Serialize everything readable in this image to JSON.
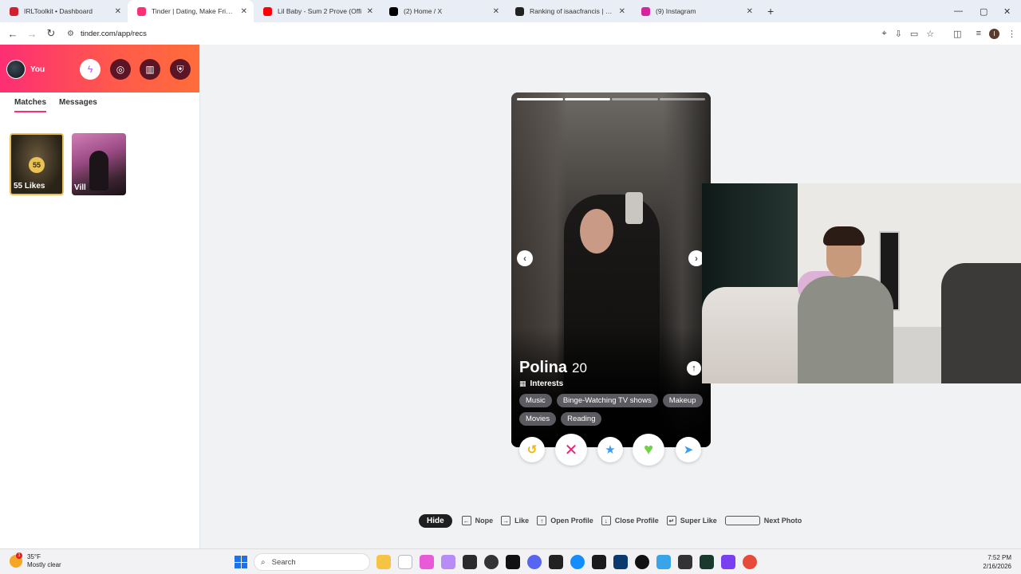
{
  "browser": {
    "tabs": [
      {
        "title": "IRLToolkit • Dashboard",
        "icon": "irltoolkit-icon",
        "color": "#d11f2e",
        "active": false
      },
      {
        "title": "Tinder | Dating, Make Friends &",
        "icon": "tinder-flame-icon",
        "color": "#fd2e74",
        "active": true
      },
      {
        "title": "Lil Baby - Sum 2 Prove (Offi",
        "icon": "youtube-icon",
        "color": "#ff0000",
        "active": false
      },
      {
        "title": "(2) Home / X",
        "icon": "x-icon",
        "color": "#000000",
        "active": false
      },
      {
        "title": "Ranking of isaacfrancis | BotRi",
        "icon": "botrix-icon",
        "color": "#222222",
        "active": false
      },
      {
        "title": "(9) Instagram",
        "icon": "instagram-icon",
        "color": "#d6249f",
        "active": false
      }
    ],
    "url": "tinder.com/app/recs",
    "profile_initial": "I"
  },
  "sidebar": {
    "user_label": "You",
    "tabs": [
      "Matches",
      "Messages"
    ],
    "active_tab": "Matches",
    "likes": {
      "count": "55",
      "label": "55 Likes"
    },
    "matches": [
      {
        "name": "Vill"
      }
    ]
  },
  "card": {
    "name": "Polina",
    "age": "20",
    "photo_count": 4,
    "current_photo": 2,
    "interests_heading": "Interests",
    "interests": [
      "Music",
      "Binge-Watching TV shows",
      "Makeup",
      "Movies",
      "Reading"
    ]
  },
  "actions": [
    {
      "name": "rewind",
      "icon": "rewind-icon",
      "color": "#f5b400"
    },
    {
      "name": "nope",
      "icon": "x-icon",
      "color": "#e8247a"
    },
    {
      "name": "super-like",
      "icon": "star-icon",
      "color": "#3a9bef"
    },
    {
      "name": "like",
      "icon": "heart-icon",
      "color": "#6fd34a"
    },
    {
      "name": "boost",
      "icon": "send-icon",
      "color": "#3a9bef"
    }
  ],
  "hints": {
    "hide": "Hide",
    "items": [
      {
        "key": "←",
        "label": "Nope"
      },
      {
        "key": "→",
        "label": "Like"
      },
      {
        "key": "↑",
        "label": "Open Profile"
      },
      {
        "key": "↓",
        "label": "Close Profile"
      },
      {
        "key": "↵",
        "label": "Super Like"
      },
      {
        "key": "",
        "label": "Next Photo"
      }
    ]
  },
  "taskbar": {
    "temp": "35°F",
    "weather": "Mostly clear",
    "search_placeholder": "Search",
    "time": "7:52 PM",
    "date": "2/16/2026"
  }
}
